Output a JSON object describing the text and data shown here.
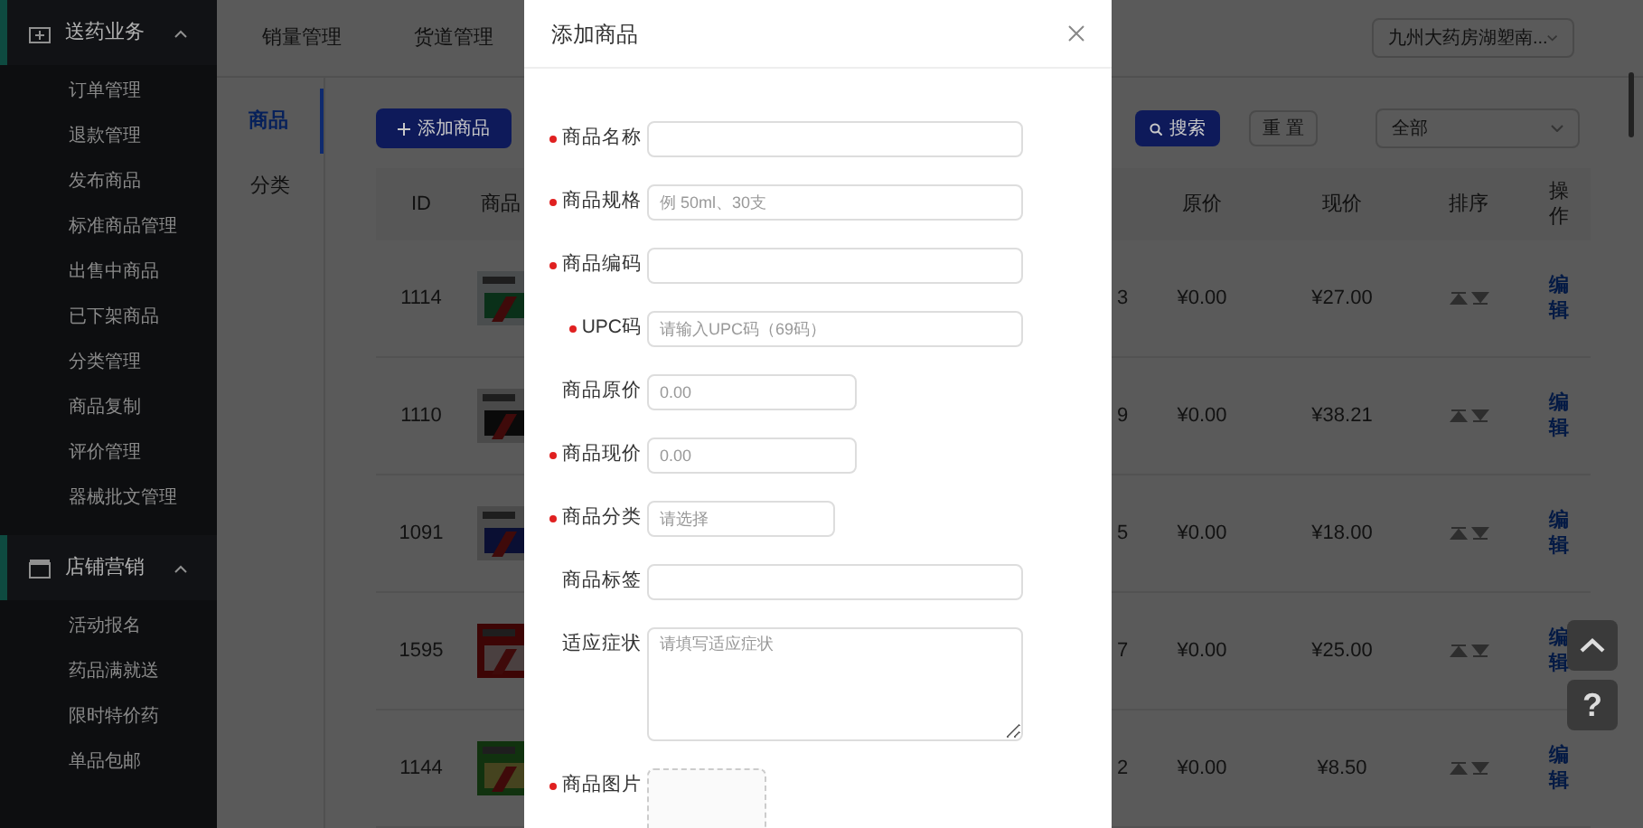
{
  "sidebar": {
    "sections": [
      {
        "title": "送药业务",
        "expanded": true,
        "items": [
          "订单管理",
          "退款管理",
          "发布商品",
          "标准商品管理",
          "出售中商品",
          "已下架商品",
          "分类管理",
          "商品复制",
          "评价管理",
          "器械批文管理"
        ]
      },
      {
        "title": "店铺营销",
        "expanded": true,
        "items": [
          "活动报名",
          "药品满就送",
          "限时特价药",
          "单品包邮"
        ]
      }
    ]
  },
  "top_tabs": [
    {
      "label": "销量管理",
      "selected": false
    },
    {
      "label": "货道管理",
      "selected": false
    }
  ],
  "store_select": {
    "value": "九州大药房湖塑南..."
  },
  "sub_nav": [
    {
      "label": "商品",
      "selected": true
    },
    {
      "label": "分类",
      "selected": false
    }
  ],
  "toolbar": {
    "add_button": "添加商品",
    "search_button": "搜索",
    "reset_button": "重 置",
    "filter_select": "全部"
  },
  "table": {
    "columns": [
      "ID",
      "商品",
      "原价",
      "现价",
      "排序",
      "操作"
    ],
    "rows": [
      {
        "id": "1114",
        "column_4": "3",
        "original_price": "¥0.00",
        "price": "¥27.00",
        "action": "编辑"
      },
      {
        "id": "1110",
        "column_4": "9",
        "original_price": "¥0.00",
        "price": "¥38.21",
        "action": "编辑"
      },
      {
        "id": "1091",
        "column_4": "5",
        "original_price": "¥0.00",
        "price": "¥18.00",
        "action": "编辑"
      },
      {
        "id": "1595",
        "column_4": "7",
        "original_price": "¥0.00",
        "price": "¥25.00",
        "action": "编辑"
      },
      {
        "id": "1144",
        "column_4": "2",
        "original_price": "¥0.00",
        "price": "¥8.50",
        "action": "编辑"
      }
    ]
  },
  "help_button": "?",
  "modal": {
    "title": "添加商品",
    "fields": [
      {
        "label": "商品名称",
        "required": true,
        "kind": "text"
      },
      {
        "label": "商品规格",
        "required": true,
        "kind": "text",
        "placeholder": "例 50ml、30支"
      },
      {
        "label": "商品编码",
        "required": true,
        "kind": "text"
      },
      {
        "label": "UPC码",
        "required": true,
        "kind": "text",
        "placeholder": "请输入UPC码（69码）"
      },
      {
        "label": "商品原价",
        "required": false,
        "kind": "short",
        "placeholder": "0.00"
      },
      {
        "label": "商品现价",
        "required": true,
        "kind": "short",
        "placeholder": "0.00"
      },
      {
        "label": "商品分类",
        "required": true,
        "kind": "select",
        "placeholder": "请选择"
      },
      {
        "label": "商品标签",
        "required": false,
        "kind": "text"
      },
      {
        "label": "适应症状",
        "required": false,
        "kind": "textarea",
        "placeholder": "请填写适应症状"
      },
      {
        "label": "商品图片",
        "required": true,
        "kind": "upload"
      }
    ]
  }
}
